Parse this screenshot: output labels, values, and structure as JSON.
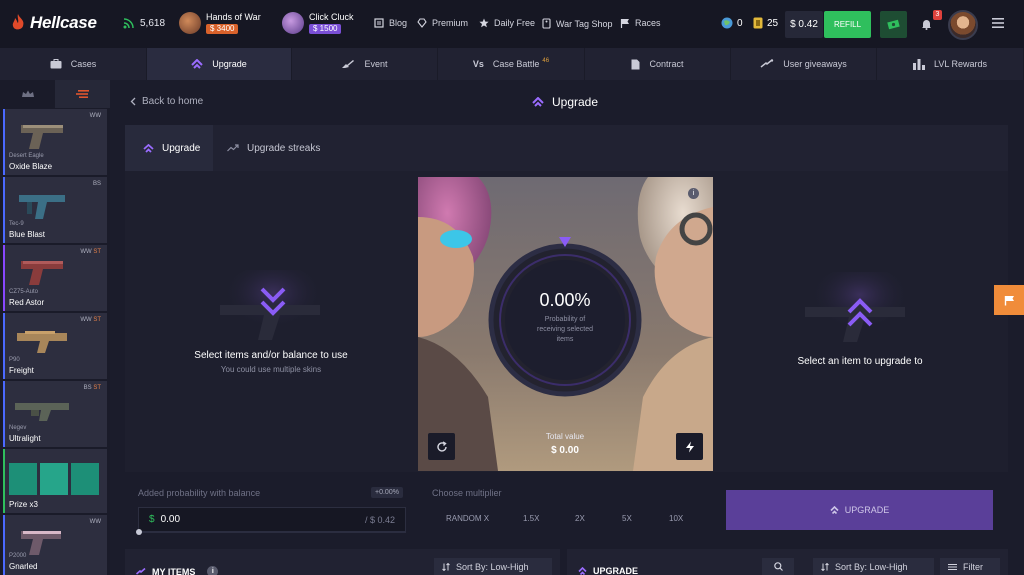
{
  "header": {
    "logo_text": "Hellcase",
    "online_count": "5,618",
    "events": [
      {
        "title": "Hands of War",
        "price": "$ 3400"
      },
      {
        "title": "Click Cluck",
        "price": "$ 1500"
      }
    ],
    "links": [
      "Blog",
      "Premium",
      "Daily Free",
      "War Tag Shop",
      "Races"
    ],
    "coins": "0",
    "tickets": "25",
    "balance": "$ 0.42",
    "refill_label": "REFILL",
    "notification_count": "3"
  },
  "nav": {
    "items": [
      {
        "label": "Cases"
      },
      {
        "label": "Upgrade"
      },
      {
        "label": "Event"
      },
      {
        "label": "Case Battle",
        "sup": "46"
      },
      {
        "label": "Contract"
      },
      {
        "label": "User giveaways"
      },
      {
        "label": "LVL Rewards"
      }
    ]
  },
  "sidebar": {
    "drops": [
      {
        "weapon": "Desert Eagle",
        "skin": "Oxide Blaze",
        "rarity": "WW",
        "st": "",
        "color": "#4b69ff"
      },
      {
        "weapon": "Tec-9",
        "skin": "Blue Blast",
        "rarity": "BS",
        "st": "",
        "color": "#4b69ff"
      },
      {
        "weapon": "CZ75-Auto",
        "skin": "Red Astor",
        "rarity": "WW",
        "st": "ST",
        "color": "#8847ff"
      },
      {
        "weapon": "P90",
        "skin": "Freight",
        "rarity": "WW",
        "st": "ST",
        "color": "#4b69ff"
      },
      {
        "weapon": "Negev",
        "skin": "Ultralight",
        "rarity": "BS",
        "st": "ST",
        "color": "#4b69ff"
      },
      {
        "weapon": "",
        "skin": "Prize x3",
        "rarity": "",
        "st": "",
        "color": "#2fbf5d"
      },
      {
        "weapon": "P2000",
        "skin": "Gnarled",
        "rarity": "WW",
        "st": "",
        "color": "#4b69ff"
      }
    ]
  },
  "page": {
    "back_label": "Back to home",
    "title": "Upgrade",
    "tab_upgrade": "Upgrade",
    "tab_streaks": "Upgrade streaks"
  },
  "left_slot": {
    "title": "Select items and/or balance to use",
    "subtitle": "You could use multiple skins"
  },
  "right_slot": {
    "title": "Select an item to upgrade to"
  },
  "arena": {
    "percent": "0.00%",
    "caption": "Probability of receiving selected items",
    "total_label": "Total value",
    "total_value": "$ 0.00"
  },
  "controls": {
    "added_prob_label": "Added probability with balance",
    "added_prob_badge": "+0.00%",
    "balance_value": "0.00",
    "balance_currency": "$",
    "balance_max": "/ $ 0.42",
    "slider_fraction": 0,
    "multiplier_label": "Choose multiplier",
    "multipliers": [
      "RANDOM X",
      "1.5X",
      "2X",
      "5X",
      "10X"
    ],
    "upgrade_button": "UPGRADE"
  },
  "bottom": {
    "my_items": "MY ITEMS",
    "sort_label": "Sort By: Low-High",
    "upgrade_label": "UPGRADE",
    "sort_label_2": "Sort By: Low-High",
    "filter_label": "Filter"
  },
  "colors": {
    "accent_purple": "#8a5cf5",
    "green": "#2fbf5d",
    "orange": "#f08c3a"
  }
}
